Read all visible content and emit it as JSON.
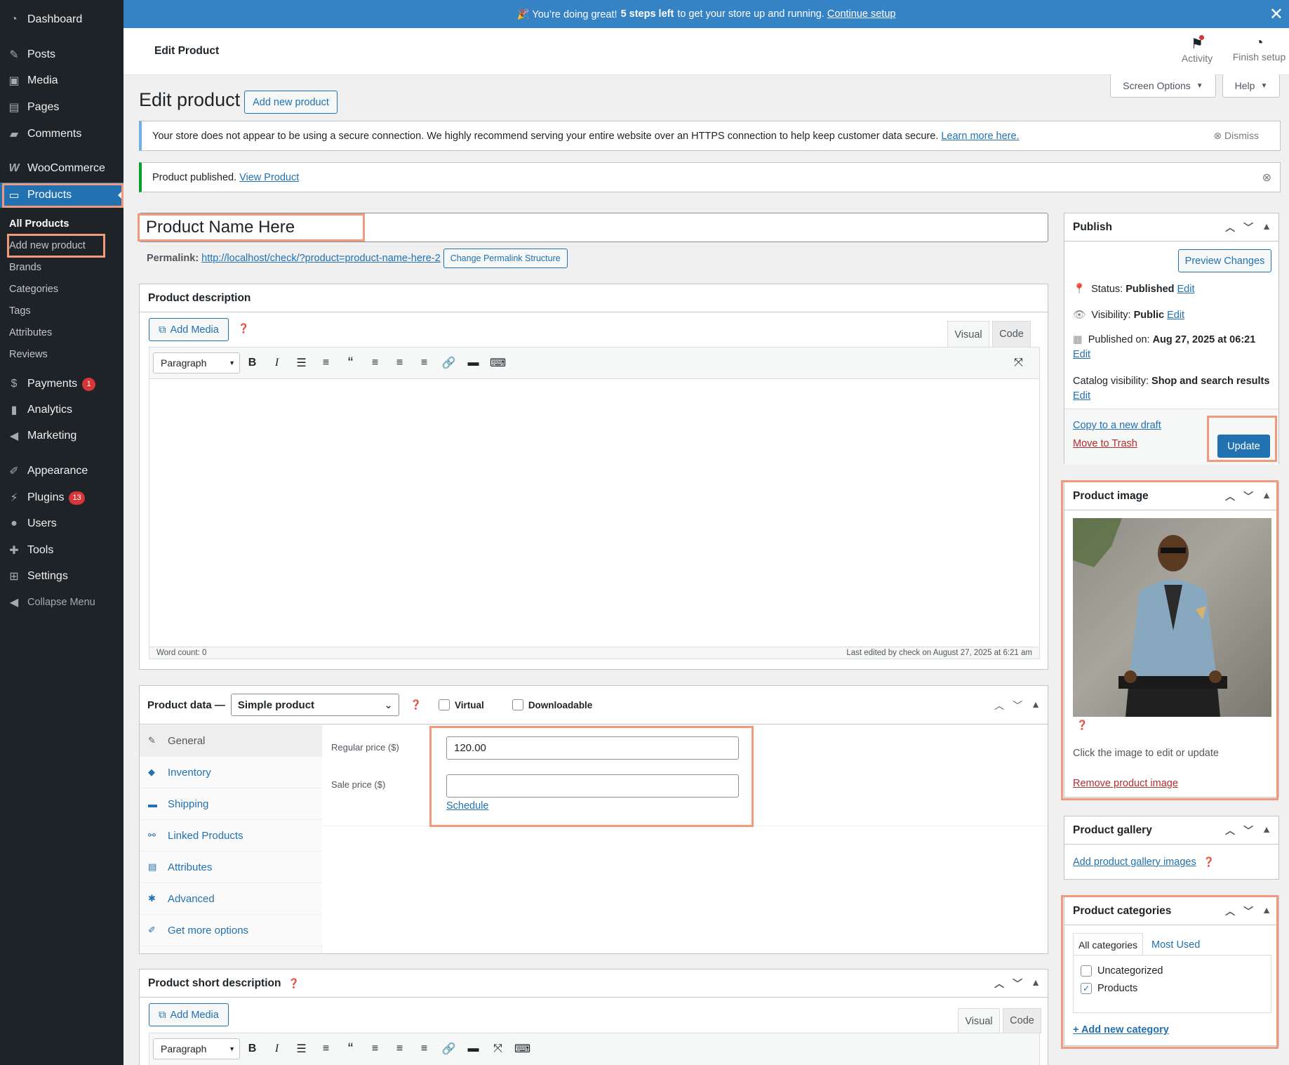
{
  "sidebar": {
    "dashboard": "Dashboard",
    "posts": "Posts",
    "media": "Media",
    "pages": "Pages",
    "comments": "Comments",
    "woocommerce": "WooCommerce",
    "products": "Products",
    "sub": [
      "All Products",
      "Add new product",
      "Brands",
      "Categories",
      "Tags",
      "Attributes",
      "Reviews"
    ],
    "payments": "Payments",
    "payments_badge": "1",
    "analytics": "Analytics",
    "marketing": "Marketing",
    "appearance": "Appearance",
    "plugins": "Plugins",
    "plugins_badge": "13",
    "users": "Users",
    "tools": "Tools",
    "settings": "Settings",
    "collapse": "Collapse Menu"
  },
  "notice": {
    "prefix": "🎉 You’re doing great!",
    "bold": "5 steps left",
    "suffix": "to get your store up and running.",
    "link": "Continue setup"
  },
  "header": {
    "title": "Edit Product",
    "activity": "Activity",
    "finish": "Finish setup"
  },
  "screen_options": "Screen Options",
  "help": "Help",
  "page_title": "Edit product",
  "add_new_button": "Add new product",
  "https_notice": {
    "text": "Your store does not appear to be using a secure connection. We highly recommend serving your entire website over an HTTPS connection to help keep customer data secure.",
    "link": "Learn more here.",
    "dismiss": "Dismiss"
  },
  "published_notice": {
    "text": "Product published.",
    "link": "View Product"
  },
  "product_title": "Product Name Here",
  "permalink": {
    "label": "Permalink:",
    "url": "http://localhost/check/?product=product-name-here-2",
    "button": "Change Permalink Structure"
  },
  "description": {
    "title": "Product description",
    "add_media": "Add Media",
    "visual": "Visual",
    "code": "Code",
    "paragraph": "Paragraph",
    "word_count": "Word count: 0",
    "last_edited": "Last edited by check on August 27, 2025 at 6:21 am"
  },
  "product_data": {
    "label": "Product data —",
    "type": "Simple product",
    "virtual": "Virtual",
    "downloadable": "Downloadable",
    "tabs": [
      "General",
      "Inventory",
      "Shipping",
      "Linked Products",
      "Attributes",
      "Advanced",
      "Get more options"
    ],
    "regular_price_label": "Regular price ($)",
    "regular_price": "120.00",
    "sale_price_label": "Sale price ($)",
    "sale_price": "",
    "schedule": "Schedule"
  },
  "short_description": {
    "title": "Product short description",
    "add_media": "Add Media",
    "visual": "Visual",
    "code": "Code",
    "paragraph": "Paragraph"
  },
  "publish": {
    "title": "Publish",
    "preview": "Preview Changes",
    "status_label": "Status:",
    "status": "Published",
    "visibility_label": "Visibility:",
    "visibility": "Public",
    "published_label": "Published on:",
    "published": "Aug 27, 2025 at 06:21",
    "catalog_label": "Catalog visibility:",
    "catalog": "Shop and search results",
    "edit": "Edit",
    "copy_draft": "Copy to a new draft",
    "trash": "Move to Trash",
    "update": "Update"
  },
  "product_image": {
    "title": "Product image",
    "hint": "Click the image to edit or update",
    "remove": "Remove product image"
  },
  "gallery": {
    "title": "Product gallery",
    "add": "Add product gallery images"
  },
  "categories": {
    "title": "Product categories",
    "tab_all": "All categories",
    "tab_most": "Most Used",
    "items": [
      {
        "label": "Uncategorized",
        "checked": false
      },
      {
        "label": "Products",
        "checked": true
      }
    ],
    "add_new": "+ Add new category"
  },
  "colors": {
    "accent": "#2271b1",
    "sidebar": "#1d2327",
    "notice_bar": "#3582c4",
    "highlight": "#f0997d"
  }
}
